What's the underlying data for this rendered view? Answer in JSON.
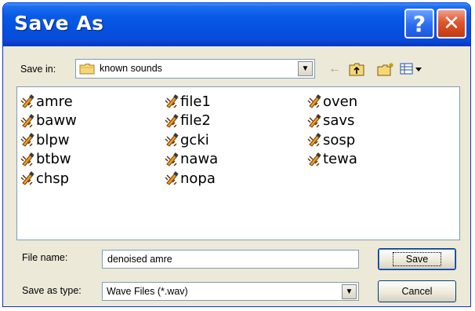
{
  "window": {
    "title": "Save As",
    "help_glyph": "?",
    "close_glyph": "✕"
  },
  "toolbar": {
    "save_in_label": "Save in:",
    "save_in_value": "known sounds",
    "dropdown_glyph": "▼",
    "back_glyph": "←",
    "icons": [
      "back-icon",
      "up-one-level-icon",
      "new-folder-icon",
      "views-menu-icon"
    ]
  },
  "files": [
    "amre",
    "baww",
    "blpw",
    "btbw",
    "chsp",
    "file1",
    "file2",
    "gcki",
    "nawa",
    "nopa",
    "oven",
    "savs",
    "sosp",
    "tewa"
  ],
  "form": {
    "file_name_label": "File name:",
    "file_name_value": "denoised amre",
    "save_type_label": "Save as type:",
    "save_type_value": "Wave Files (*.wav)",
    "save_button": "Save",
    "cancel_button": "Cancel"
  },
  "colors": {
    "title_bar": "#0551e0",
    "dialog_bg": "#ece9d8",
    "close_button": "#e0552e",
    "help_button": "#2a6df2"
  }
}
